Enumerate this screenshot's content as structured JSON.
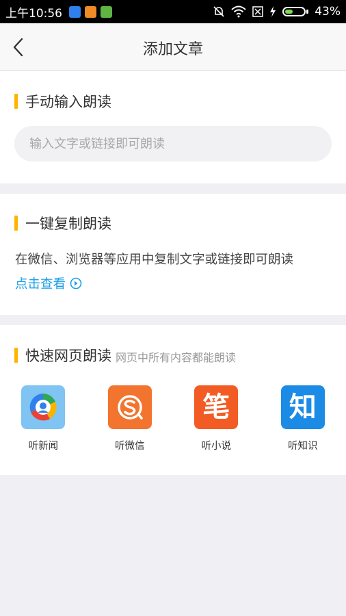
{
  "status_bar": {
    "time": "上午10:56",
    "battery": "43%",
    "battery_level": 0.43,
    "battery_color": "#7ed957",
    "app_icons": [
      {
        "name": "shield-app-icon",
        "color": "#2f80ed"
      },
      {
        "name": "uc-app-icon",
        "color": "#f08a24"
      },
      {
        "name": "sim-app-icon",
        "color": "#5fb342"
      }
    ],
    "icons": [
      "mute-bell-icon",
      "wifi-icon",
      "sim-off-icon",
      "charging-bolt-icon",
      "battery-icon"
    ]
  },
  "navbar": {
    "title": "添加文章",
    "back_icon": "chevron-left-icon"
  },
  "manual": {
    "title": "手动输入朗读",
    "placeholder": "输入文字或链接即可朗读",
    "value": ""
  },
  "copy": {
    "title": "一键复制朗读",
    "description": "在微信、浏览器等应用中复制文字或链接即可朗读",
    "link_label": "点击查看",
    "link_icon": "arrow-circle-right-icon"
  },
  "quick": {
    "title": "快速网页朗读",
    "subtitle": "网页中所有内容都能朗读",
    "items": [
      {
        "label": "听新闻",
        "icon": "news-app-icon",
        "color": "#7fc4f2"
      },
      {
        "label": "听微信",
        "icon": "sogou-app-icon",
        "color": "#f2742e"
      },
      {
        "label": "听小说",
        "icon": "novel-app-icon",
        "glyph": "笔",
        "color": "#f25c24"
      },
      {
        "label": "听知识",
        "icon": "zhihu-app-icon",
        "glyph": "知",
        "color": "#1b8be6"
      }
    ]
  },
  "colors": {
    "accent": "#ffb400",
    "link": "#1b9ee6",
    "background": "#efeff4"
  }
}
